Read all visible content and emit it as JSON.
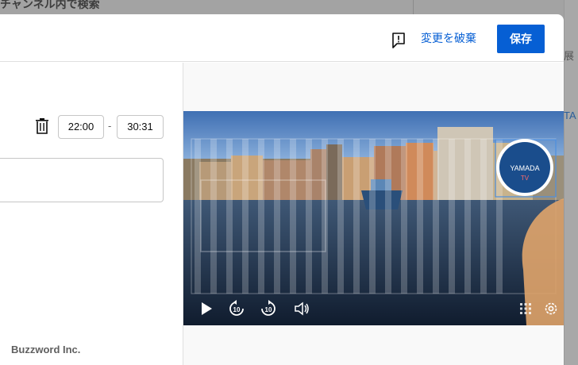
{
  "background": {
    "title": "チャンネル内で検索",
    "right_text_top": "展",
    "right_text_mid": "TA"
  },
  "header": {
    "discard_label": "変更を破棄",
    "save_label": "保存"
  },
  "segment": {
    "start_time": "22:00",
    "separator": "-",
    "end_time": "30:31",
    "text_value": ""
  },
  "footer": {
    "brand": "Buzzword Inc."
  },
  "player": {
    "watermark_line1": "YAMADA",
    "watermark_line2": "TV",
    "controls": [
      "play-icon",
      "rewind-10-icon",
      "forward-10-icon",
      "volume-icon",
      "grid-icon",
      "settings-icon"
    ]
  },
  "colors": {
    "accent": "#065fd4",
    "overlay": "#a3a3a3"
  }
}
